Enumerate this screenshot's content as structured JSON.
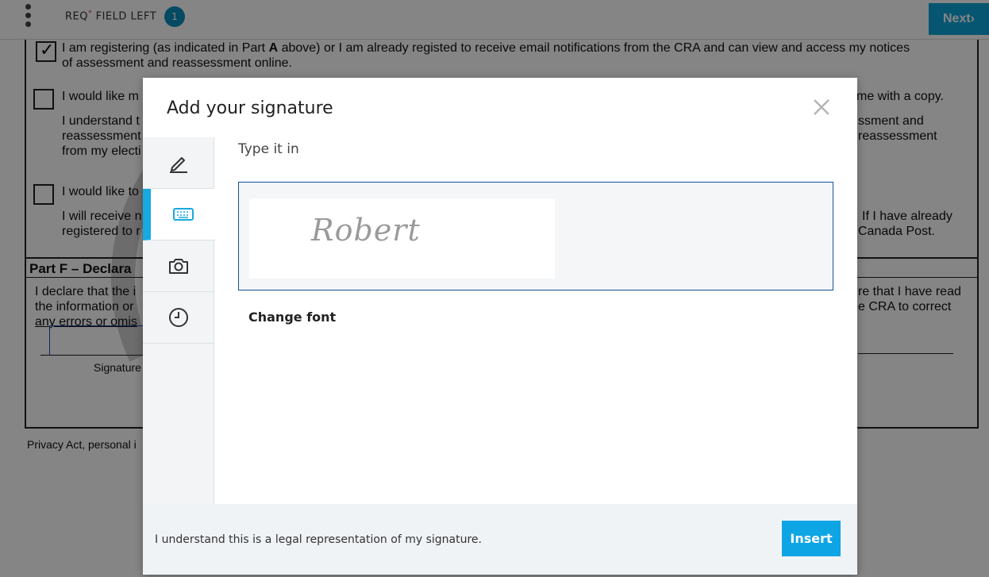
{
  "toolbar": {
    "req_label": "REQ",
    "req_star": "*",
    "req_suffix": "FIELD LEFT",
    "req_count": "1",
    "next_label": "Next"
  },
  "document": {
    "line1_a": "I am registering (as indicated in Part ",
    "line1_bold": "A",
    "line1_b": " above) or I am already registe",
    "line1_c": "d to receive email notifications from the CRA and can view and access my notices",
    "line1_2": "of assessment and reassessment online.",
    "line2": "I would like m",
    "line2_right": "me with a copy.",
    "line3_1": "I understand t",
    "line3_2": "reassessment",
    "line3_3": "from my electi",
    "line3_right1": "ssment and",
    "line3_right2": "reassessment",
    "line4": "I would like to",
    "line5_1": "I will receive n",
    "line5_2": "registered to r",
    "line5_right1": "If I have already",
    "line5_right2": "Canada Post.",
    "partf": "Part F – Declara",
    "decl_1": "I declare that the i",
    "decl_2": "the information or",
    "decl_3": "any errors or omis",
    "decl_right1": "re that I have read",
    "decl_right2": "e CRA to correct",
    "signature_caption": "Signature",
    "privacy": "Privacy Act, personal i"
  },
  "modal": {
    "title": "Add your signature",
    "tabs": [
      {
        "name": "draw",
        "icon": "pen-icon"
      },
      {
        "name": "type",
        "icon": "keyboard-icon",
        "active": true
      },
      {
        "name": "upload",
        "icon": "camera-icon"
      },
      {
        "name": "recent",
        "icon": "clock-icon"
      }
    ],
    "section_label": "Type it in",
    "signature_value": "Robert",
    "change_font_label": "Change font",
    "footer_text": "I understand this is a legal representation of my signature.",
    "insert_label": "Insert",
    "accent_color": "#0ea5e4"
  }
}
